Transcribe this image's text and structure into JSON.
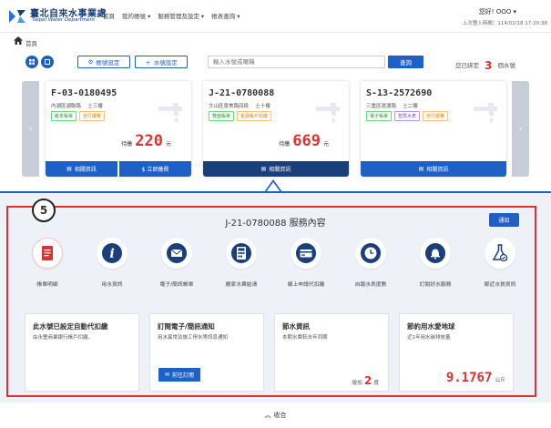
{
  "header": {
    "brand": "臺北自來水事業處",
    "brand_en": "Taipei Water Department",
    "nav": [
      "首頁",
      "我的帳號 ▾",
      "服務管理及設定 ▾",
      "帳表查詢 ▾"
    ],
    "greeting": "您好! OOO ▾",
    "last_login": "上次登入時間：114/02/18 17:20:38"
  },
  "breadcrumb": "首頁",
  "toolbar": {
    "account_setting": "帳號設定",
    "add_account": "水號設定",
    "search_placeholder": "輸入水號或暱稱",
    "query": "查詢",
    "bound_prefix": "您已綁定",
    "bound_count": "3",
    "bound_suffix": "個水號"
  },
  "cards": [
    {
      "account": "F-03-0180495",
      "address": "內湖區湖聯路　 土三樓",
      "tags": [
        {
          "text": "紙本帳單",
          "c": "t-g"
        },
        {
          "text": "自行繳費",
          "c": "t-o"
        }
      ],
      "due_label": "待繳",
      "amount": "220",
      "unit": "元",
      "buttons": [
        "相關資訊",
        "$ 立即繳費"
      ]
    },
    {
      "account": "J-21-0780088",
      "address": "文山區景美路四段　 土十樓",
      "tags": [
        {
          "text": "雙面帳單",
          "c": "t-g"
        },
        {
          "text": "金融帳戶扣繳",
          "c": "t-o"
        }
      ],
      "due_label": "待繳",
      "amount": "669",
      "unit": "元",
      "buttons": [
        "相關資訊"
      ]
    },
    {
      "account": "S-13-2572690",
      "address": "三重區運運路　 土二樓",
      "tags": [
        {
          "text": "電子帳單",
          "c": "t-g"
        },
        {
          "text": "智慧水表",
          "c": "t-p"
        },
        {
          "text": "自行繳費",
          "c": "t-o"
        }
      ],
      "due_label": "",
      "amount": "",
      "unit": "",
      "buttons": [
        "相關資訊"
      ]
    }
  ],
  "step_number": "5",
  "service": {
    "title": "J-21-0780088 服務內容",
    "notify": "通知",
    "items": [
      {
        "label": "帳單明細",
        "icon": "bill-icon",
        "color": "#e03131"
      },
      {
        "label": "用水資訊",
        "icon": "info-icon",
        "color": "#1b3f7a"
      },
      {
        "label": "電子/簡訊帳單",
        "icon": "mail-icon",
        "color": "#1b3f7a"
      },
      {
        "label": "搬家水費結清",
        "icon": "calculator-icon",
        "color": "#1b3f7a"
      },
      {
        "label": "線上申請代扣繳",
        "icon": "card-icon",
        "color": "#1b3f7a"
      },
      {
        "label": "自報水表度數",
        "icon": "clock-icon",
        "color": "#1b3f7a"
      },
      {
        "label": "訂閱好水服務",
        "icon": "bell-icon",
        "color": "#1b3f7a"
      },
      {
        "label": "鄰近水質資訊",
        "icon": "flask-icon",
        "color": "#1b3f7a"
      }
    ]
  },
  "info": [
    {
      "title": "此水號已設定自動代扣繳",
      "sub": "由永豐商業銀行帳戶扣繳。"
    },
    {
      "title": "訂閱電子/簡訊通知",
      "sub": "用水異常及施工停水等訊息通知",
      "button": "前往訂閱"
    },
    {
      "title": "節水資訊",
      "sub": "本期水費較去年同期",
      "increase_label": "增加",
      "increase_value": "2",
      "increase_unit": "度"
    },
    {
      "title": "節約用水愛地球",
      "sub": "近1年用水碳排放量",
      "co2_value": "9.1767",
      "co2_unit": "公斤"
    }
  ],
  "collapse": "收合"
}
